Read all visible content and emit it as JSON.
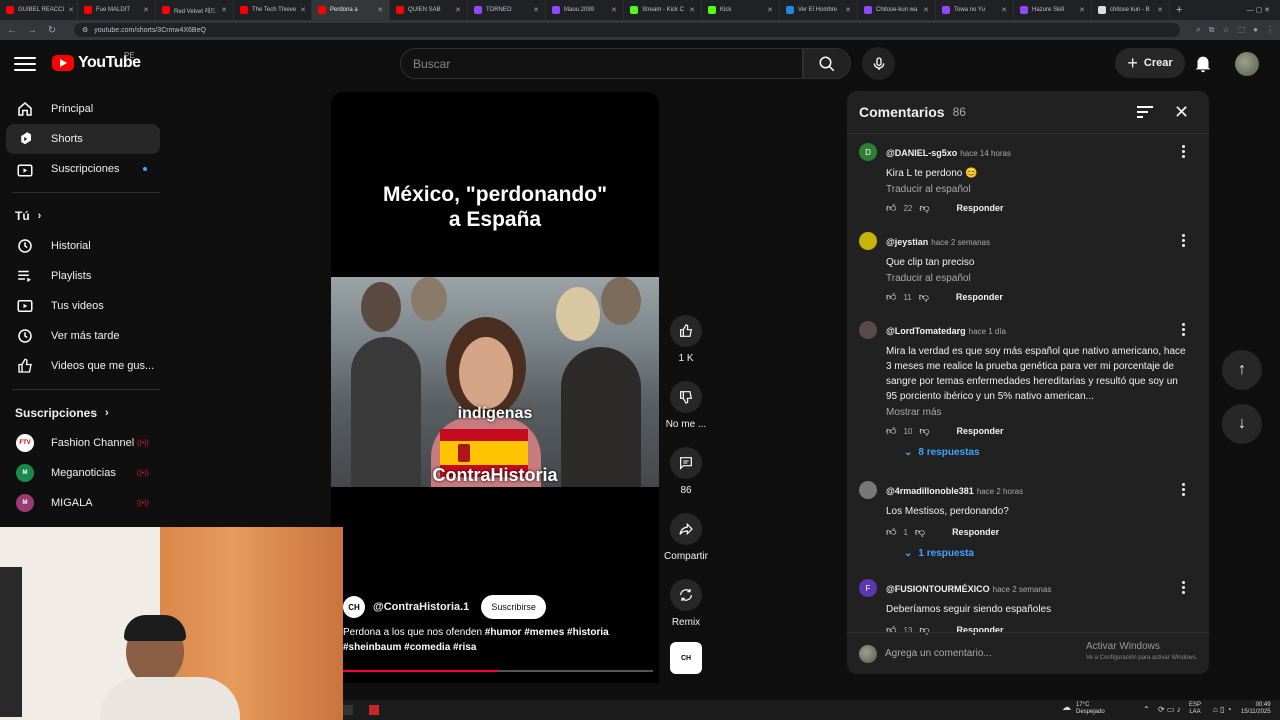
{
  "browser": {
    "tabs": [
      {
        "label": "GUIBEL REACCI",
        "color": "#ff0000",
        "active": false
      },
      {
        "label": "Fue MALDIT",
        "color": "#ff0000",
        "active": false
      },
      {
        "label": "Red Velvet 레드",
        "color": "#ff0000",
        "active": false
      },
      {
        "label": "The Tech Thieve",
        "color": "#ff0000",
        "active": false
      },
      {
        "label": "Perdona a",
        "color": "#ff0000",
        "active": true
      },
      {
        "label": "QUIEN SAB",
        "color": "#ff0000",
        "active": false
      },
      {
        "label": "TORNEO",
        "color": "#9146ff",
        "active": false
      },
      {
        "label": "Maou 2099",
        "color": "#9146ff",
        "active": false
      },
      {
        "label": "Stream - Kick C",
        "color": "#53fc18",
        "active": false
      },
      {
        "label": "Kick",
        "color": "#53fc18",
        "active": false
      },
      {
        "label": "Ver El Hombre",
        "color": "#1e88e5",
        "active": false
      },
      {
        "label": "Chitose-kun wa",
        "color": "#9146ff",
        "active": false
      },
      {
        "label": "Towa no Yu",
        "color": "#9146ff",
        "active": false
      },
      {
        "label": "Hazure Skill",
        "color": "#9146ff",
        "active": false
      },
      {
        "label": "chitose kun - B",
        "color": "#dddddd",
        "active": false
      }
    ],
    "url": "youtube.com/shorts/3Crmw4X6BeQ"
  },
  "header": {
    "logo": "YouTube",
    "country": "PE",
    "search_placeholder": "Buscar",
    "create_label": "Crear"
  },
  "sidebar": {
    "main": [
      {
        "label": "Principal",
        "icon": "home-icon"
      },
      {
        "label": "Shorts",
        "icon": "shorts-icon"
      },
      {
        "label": "Suscripciones",
        "icon": "subscriptions-icon"
      }
    ],
    "you_heading": "Tú",
    "you": [
      {
        "label": "Historial",
        "icon": "history-icon"
      },
      {
        "label": "Playlists",
        "icon": "playlists-icon"
      },
      {
        "label": "Tus videos",
        "icon": "your-videos-icon"
      },
      {
        "label": "Ver más tarde",
        "icon": "watch-later-icon"
      },
      {
        "label": "Videos que me gus...",
        "icon": "liked-icon"
      }
    ],
    "subs_heading": "Suscripciones",
    "channels": [
      {
        "label": "Fashion Channel",
        "abbr": "FTV",
        "bg": "#ffffff",
        "fg": "#cc0000"
      },
      {
        "label": "Meganoticias",
        "abbr": "M",
        "bg": "#1a8a4a",
        "fg": "#ffffff"
      },
      {
        "label": "MIGALA",
        "abbr": "M",
        "bg": "#9b3b74",
        "fg": "#ffffff"
      }
    ]
  },
  "video": {
    "title_line1": "México, \"perdonando\"",
    "title_line2": "a España",
    "caption_word": "indígenas",
    "watermark": "ContraHistoria",
    "channel": "@ContraHistoria.1",
    "subscribe": "Suscribirse",
    "desc_line1_plain": "Perdona a los que nos ofenden ",
    "desc_line1_tags": "#humor #memes #historia",
    "desc_line2_tags": "#sheinbaum #comedia #risa",
    "progress": 0.5
  },
  "actions": {
    "like_count": "1 K",
    "dislike_label": "No me ...",
    "comment_count": "86",
    "share_label": "Compartir",
    "remix_label": "Remix"
  },
  "comments": {
    "title": "Comentarios",
    "count": "86",
    "items": [
      {
        "user": "@DANIEL-sg5xo",
        "time": "hace 14 horas",
        "text": "Kira L te perdono 😊",
        "translate": "Traducir al español",
        "likes": "22",
        "reply": "Responder",
        "avatar": "D",
        "avatar_bg": "#2e7d32"
      },
      {
        "user": "@jeystian",
        "time": "hace 2 semanas",
        "text": "Que clip tan preciso",
        "translate": "Traducir al español",
        "likes": "11",
        "reply": "Responder",
        "avatar": "",
        "avatar_bg": "#c8b400"
      },
      {
        "user": "@LordTomatedarg",
        "time": "hace 1 día",
        "text": "Mira la verdad es que soy más español que nativo americano, hace 3 meses me realice la prueba genética para ver mi porcentaje de sangre por temas enfermedades hereditarias y resultó que soy un 95 porciento ibérico y un 5% nativo american...",
        "more": "Mostrar más",
        "likes": "10",
        "reply": "Responder",
        "replies": "8 respuestas",
        "avatar": "",
        "avatar_bg": "#5a4a4a"
      },
      {
        "user": "@4rmadillonoble381",
        "time": "hace 2 horas",
        "text": "Los Mestisos, perdonando?",
        "likes": "1",
        "reply": "Responder",
        "replies": "1 respuesta",
        "avatar": "",
        "avatar_bg": "#777777"
      },
      {
        "user": "@FUSIONTOURMÉXICO",
        "time": "hace 2 semanas",
        "text": "Deberíamos seguir siendo españoles",
        "likes": "13",
        "reply": "Responder",
        "avatar": "F",
        "avatar_bg": "#5e35b1"
      }
    ],
    "input_placeholder": "Agrega un comentario..."
  },
  "windows": {
    "activate_title": "Activar Windows",
    "activate_sub": "Ve a Configuración para activar Windows.",
    "weather_temp": "17°C",
    "weather_desc": "Despejado",
    "lang": "ESP",
    "lang2": "LAA",
    "time": "00:49",
    "date": "15/11/2025"
  }
}
